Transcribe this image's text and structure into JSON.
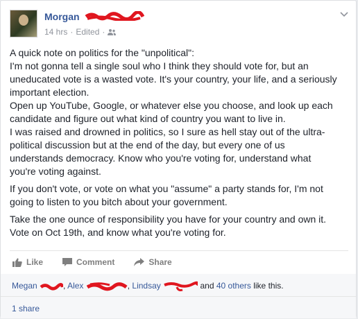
{
  "post": {
    "author_name": "Morgan",
    "timestamp": "14 hrs",
    "edited_label": "Edited",
    "separator": "·",
    "privacy_icon": "friends-icon",
    "menu_icon": "chevron-down-icon",
    "body": {
      "lines": [
        "A quick note on politics for the \"unpolitical\":",
        "I'm not gonna tell a single soul who I think they should vote for, but an",
        "uneducated vote is a wasted vote. It's your country, your life, and a seriously",
        "important election.",
        "Open up YouTube, Google, or whatever else you choose, and look up each",
        "candidate and figure out what kind of country you want to live in.",
        "I was raised and drowned in politics, so I sure as hell stay out of the ultra-",
        "political discussion but at the end of the day, but every one of us",
        "understands democracy. Know who you're voting for, understand what",
        "you're voting against."
      ],
      "para2_lines": [
        "If you don't vote, or vote on what you \"assume\" a party stands for, I'm not",
        "going to listen to you bitch about your government."
      ],
      "para3_lines": [
        "Take the one ounce of responsibility you have for your country and own it.",
        "Vote on Oct 19th, and know what you're voting for."
      ]
    },
    "actions": {
      "like": "Like",
      "comment": "Comment",
      "share": "Share"
    },
    "likes": {
      "name1": "Megan",
      "name2": "Alex",
      "name3": "Lindsay",
      "others": "40 others",
      "suffix": " like this.",
      "and": " and "
    },
    "shares": "1 share",
    "colors": {
      "link": "#365899",
      "redaction": "#e0161f"
    }
  }
}
